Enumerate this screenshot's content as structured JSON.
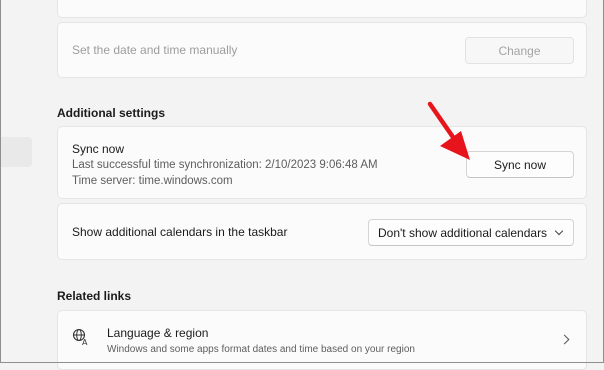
{
  "manual": {
    "label": "Set the date and time manually",
    "button": "Change"
  },
  "additional_settings": {
    "heading": "Additional settings",
    "sync": {
      "title": "Sync now",
      "last_sync": "Last successful time synchronization: 2/10/2023 9:06:48 AM",
      "server": "Time server: time.windows.com",
      "button": "Sync now"
    },
    "calendars": {
      "label": "Show additional calendars in the taskbar",
      "selected": "Don't show additional calendars"
    }
  },
  "related_links": {
    "heading": "Related links",
    "items": [
      {
        "icon": "language-region-icon",
        "title": "Language & region",
        "subtitle": "Windows and some apps format dates and time based on your region"
      }
    ]
  },
  "colors": {
    "background": "#f3f3f3",
    "card": "#fbfbfb",
    "annotation_arrow": "#e8141c"
  }
}
